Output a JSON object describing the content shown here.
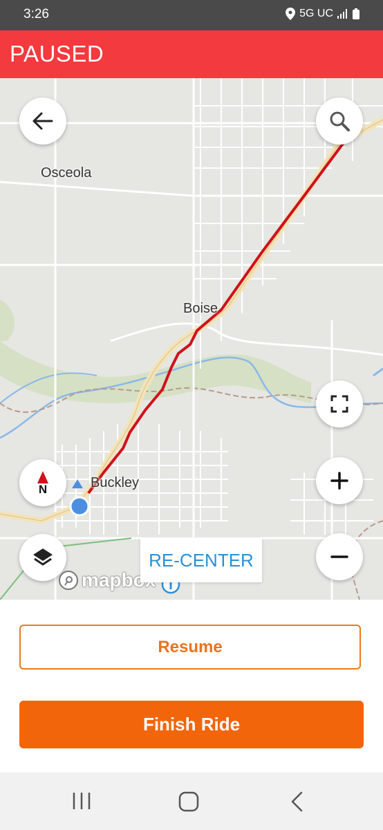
{
  "status_bar": {
    "time": "3:26",
    "network": "5G UC"
  },
  "banner": {
    "text": "PAUSED",
    "color": "#f33a3f"
  },
  "map": {
    "labels": {
      "osceola": "Osceola",
      "boise": "Boise",
      "buckley": "Buckley"
    },
    "recenter_label": "RE-CENTER",
    "logo_text": "mapbox",
    "compass_letter": "N"
  },
  "actions": {
    "resume_label": "Resume",
    "finish_label": "Finish Ride"
  },
  "colors": {
    "accent": "#f3650a",
    "route": "#d0111a",
    "recenter": "#2a8fd6"
  }
}
